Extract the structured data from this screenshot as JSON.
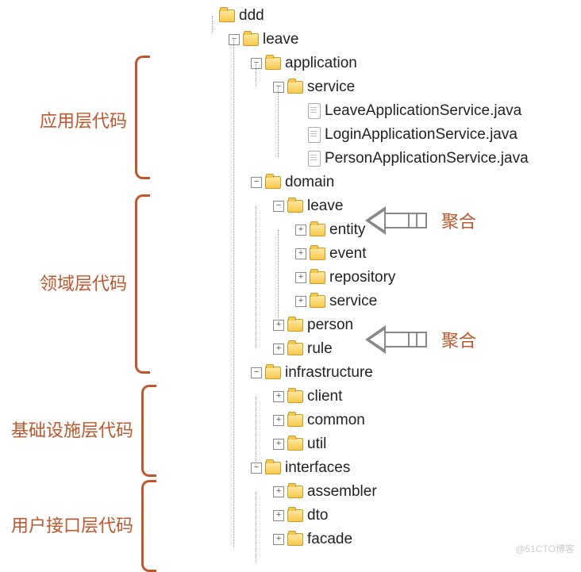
{
  "tree": {
    "root": "ddd",
    "leave": "leave",
    "application": "application",
    "service": "service",
    "files": {
      "f1": "LeaveApplicationService.java",
      "f2": "LoginApplicationService.java",
      "f3": "PersonApplicationService.java"
    },
    "domain": "domain",
    "domain_leave": "leave",
    "entity": "entity",
    "event": "event",
    "repository": "repository",
    "domain_service": "service",
    "person": "person",
    "rule": "rule",
    "infrastructure": "infrastructure",
    "client": "client",
    "common": "common",
    "util": "util",
    "interfaces": "interfaces",
    "assembler": "assembler",
    "dto": "dto",
    "facade": "facade"
  },
  "annotations": {
    "app_layer": "应用层代码",
    "domain_layer": "领域层代码",
    "infra_layer": "基础设施层代码",
    "interface_layer": "用户接口层代码",
    "aggregate": "聚合"
  },
  "watermark": "@51CTO博客"
}
